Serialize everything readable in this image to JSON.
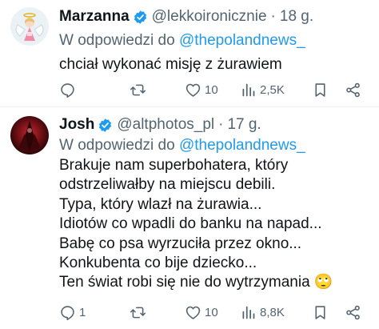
{
  "tweets": [
    {
      "author": {
        "name": "Marzanna",
        "handle": "@lekkoironicznie",
        "avatar": "angel-avatar"
      },
      "time": "18 g.",
      "reply_prefix": "W odpowiedzi do",
      "reply_mention": "@thepolandnews_",
      "text_lines": [
        "chciał wykonać misję z żurawiem"
      ],
      "stats": {
        "replies": "",
        "retweets": "",
        "likes": "10",
        "views": "2,5K"
      }
    },
    {
      "author": {
        "name": "Josh",
        "handle": "@altphotos_pl",
        "avatar": "dark-red-avatar"
      },
      "time": "17 g.",
      "reply_prefix": "W odpowiedzi do",
      "reply_mention": "@thepolandnews_",
      "text_lines": [
        "Brakuje nam superbohatera, który",
        "odstrzeliwałby na miejscu debili.",
        "Typa, który wlazł na żurawia...",
        "Idiotów co wpadli do banku na napad...",
        "Babę co psa wyrzuciła przez okno...",
        "Konkubenta co bije dziecko...",
        "Ten świat robi się nie do wytrzymania 🙄"
      ],
      "stats": {
        "replies": "1",
        "retweets": "",
        "likes": "10",
        "views": "8,8K"
      }
    }
  ],
  "separator": "·",
  "icons": {
    "verified": "verified-badge-icon",
    "reply": "reply-icon",
    "retweet": "retweet-icon",
    "like": "heart-icon",
    "views": "views-icon",
    "bookmark": "bookmark-icon",
    "share": "share-icon"
  },
  "colors": {
    "text": "#0f1419",
    "secondary": "#536471",
    "link": "#1d9bf0",
    "verified": "#1d9bf0",
    "divider": "#eff3f4"
  }
}
